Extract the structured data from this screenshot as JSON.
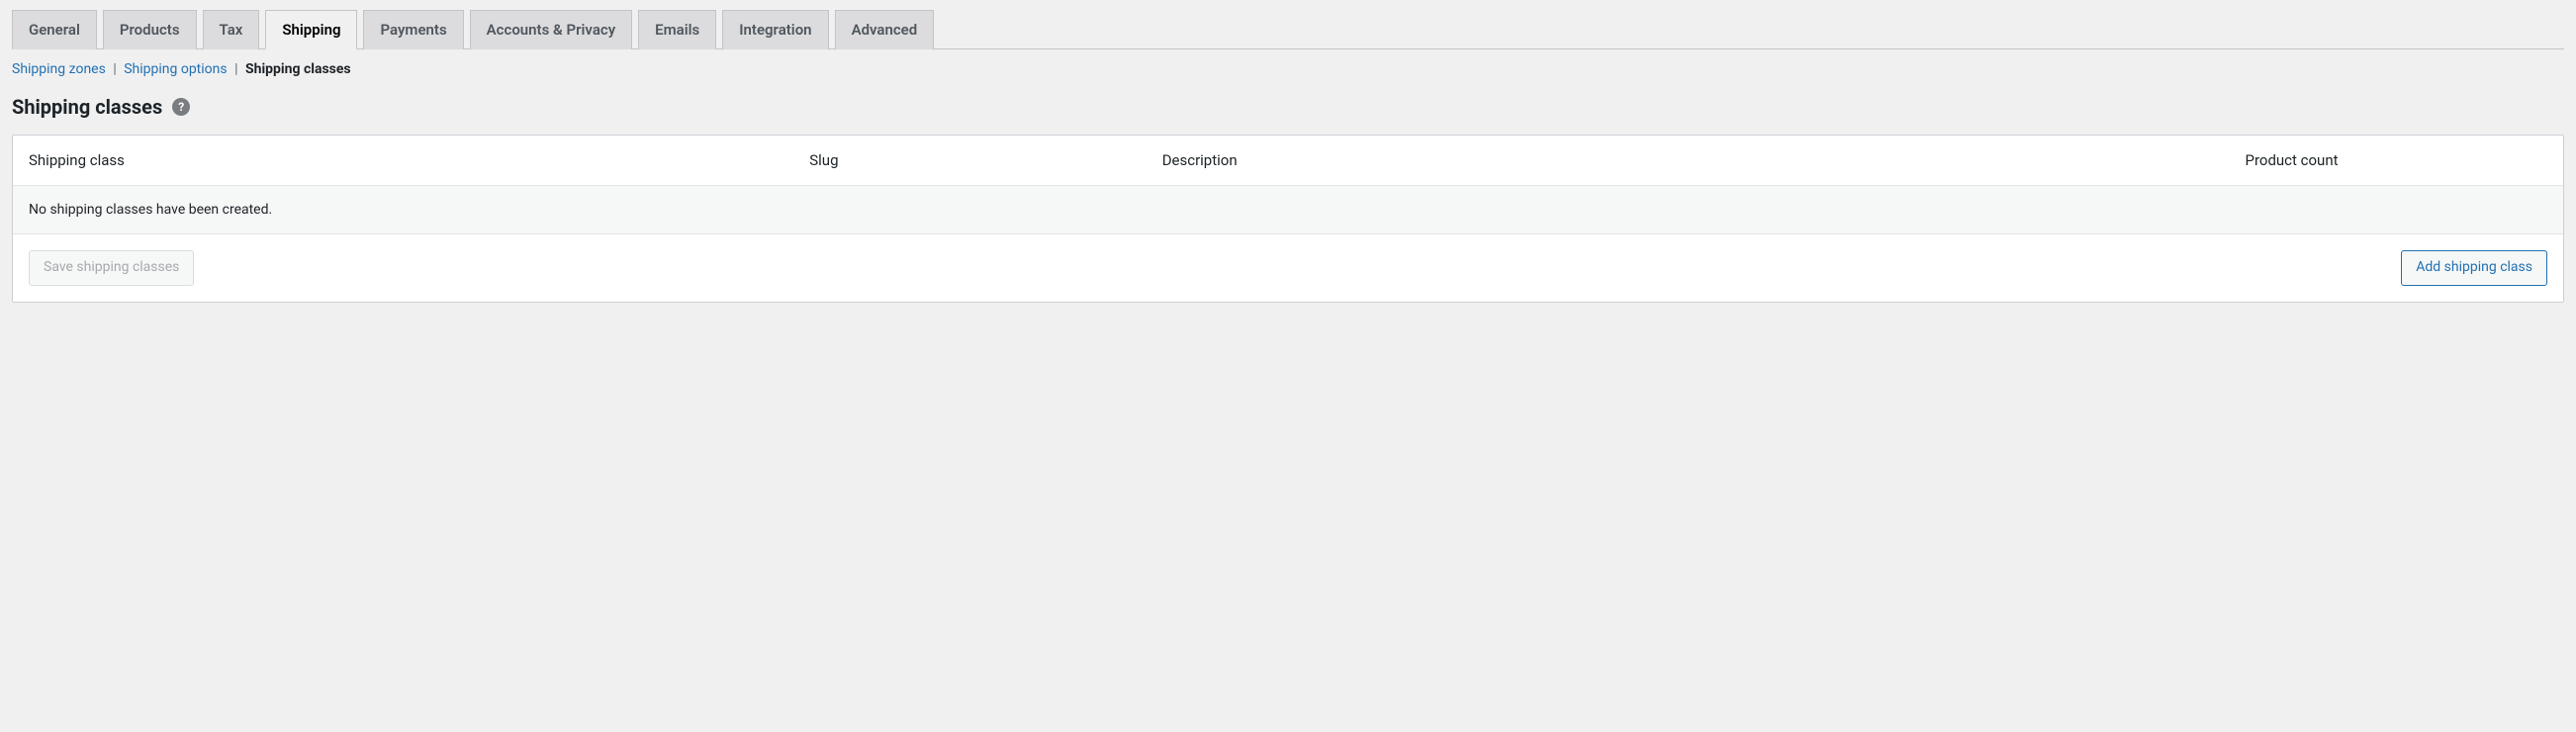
{
  "tabs": [
    {
      "label": "General",
      "active": false
    },
    {
      "label": "Products",
      "active": false
    },
    {
      "label": "Tax",
      "active": false
    },
    {
      "label": "Shipping",
      "active": true
    },
    {
      "label": "Payments",
      "active": false
    },
    {
      "label": "Accounts & Privacy",
      "active": false
    },
    {
      "label": "Emails",
      "active": false
    },
    {
      "label": "Integration",
      "active": false
    },
    {
      "label": "Advanced",
      "active": false
    }
  ],
  "subnav": {
    "zones": "Shipping zones",
    "options": "Shipping options",
    "classes": "Shipping classes"
  },
  "heading": "Shipping classes",
  "help_glyph": "?",
  "table": {
    "headers": {
      "class": "Shipping class",
      "slug": "Slug",
      "description": "Description",
      "count": "Product count"
    },
    "empty_message": "No shipping classes have been created."
  },
  "buttons": {
    "save": "Save shipping classes",
    "add": "Add shipping class"
  }
}
